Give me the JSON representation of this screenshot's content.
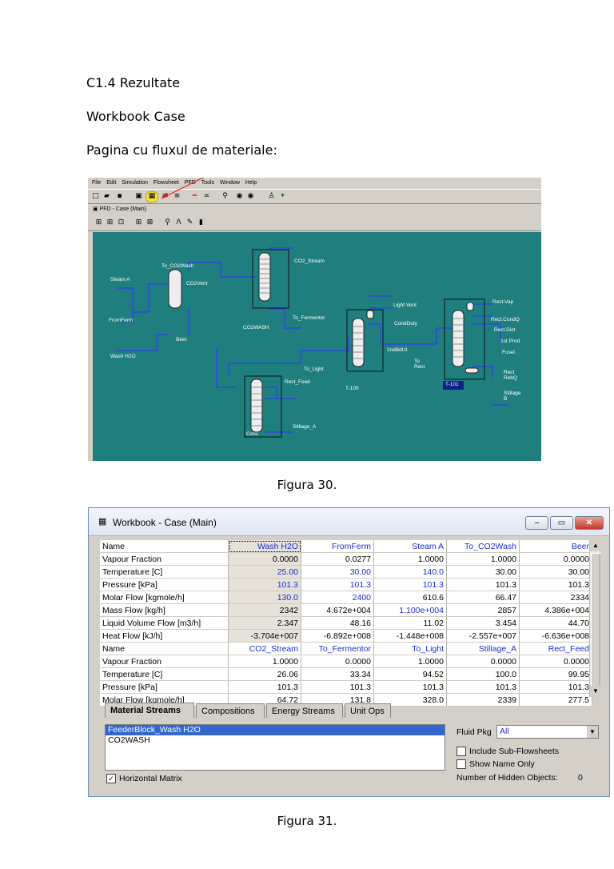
{
  "doc": {
    "section": "C1.4 Rezultate",
    "subsection": "Workbook Case",
    "intro": "Pagina cu fluxul de materiale:",
    "caption1": "Figura 30.",
    "caption2": "Figura 31."
  },
  "pfd": {
    "menu": [
      "File",
      "Edit",
      "Simulation",
      "Flowsheet",
      "PFD",
      "Tools",
      "Window",
      "Help"
    ],
    "window_title": "PFD - Case (Main)",
    "labels": {
      "steam_a": "Steam A",
      "from_ferm": "FromFerm",
      "wash_h2o": "Wash H2O",
      "to_co2wash": "To_CO2Wash",
      "co2vent": "CO2Vent",
      "beer": "Beer",
      "co2_stream": "CO2_Stream",
      "co2wash": "CO2WASH",
      "to_fermentor": "To_Fermentor",
      "light_vent": "Light Vent",
      "cond_duty": "CondDuty",
      "reb_duty": "2ndBdUt",
      "to_rect": "To Rect",
      "to_light": "To_Light",
      "rect_feed": "Rect_Feed",
      "t100": "T-100",
      "conc": "Conc",
      "stillage_a": "Stillage_A",
      "rect_vap": "Rect.Vap",
      "rect_condq": "Rect.CondQ",
      "rect_dist": "Rect.Dist",
      "prod1": "1st Prod",
      "fusel": "Fusel",
      "rect_rebq": "Rect RebQ",
      "stillage_b": "Stillage B",
      "t101": "T-101"
    }
  },
  "workbook": {
    "title": "Workbook - Case (Main)",
    "buttons": {
      "min": "–",
      "max": "▭",
      "close": "✕"
    },
    "rows": [
      {
        "name": "Name",
        "hdr": true,
        "cells": [
          "Wash H2O",
          "FromFerm",
          "Steam A",
          "To_CO2Wash",
          "Beer"
        ]
      },
      {
        "name": "Vapour Fraction",
        "cells": [
          "0.0000",
          "0.0277",
          "1.0000",
          "1.0000",
          "0.0000"
        ]
      },
      {
        "name": "Temperature [C]",
        "cells": [
          "25.00",
          "30.00",
          "140.0",
          "30.00",
          "30.00"
        ],
        "blue": [
          0,
          1,
          2
        ]
      },
      {
        "name": "Pressure [kPa]",
        "cells": [
          "101.3",
          "101.3",
          "101.3",
          "101.3",
          "101.3"
        ],
        "blue": [
          0,
          1,
          2
        ]
      },
      {
        "name": "Molar Flow [kgmole/h]",
        "cells": [
          "130.0",
          "2400",
          "610.6",
          "66.47",
          "2334"
        ],
        "blue": [
          0,
          1
        ]
      },
      {
        "name": "Mass Flow [kg/h]",
        "cells": [
          "2342",
          "4.672e+004",
          "1.100e+004",
          "2857",
          "4.386e+004"
        ],
        "blue": [
          2
        ]
      },
      {
        "name": "Liquid Volume Flow [m3/h]",
        "cells": [
          "2.347",
          "48.16",
          "11.02",
          "3.454",
          "44.70"
        ]
      },
      {
        "name": "Heat Flow [kJ/h]",
        "cells": [
          "-3.704e+007",
          "-6.892e+008",
          "-1.448e+008",
          "-2.557e+007",
          "-6.636e+008"
        ]
      },
      {
        "name": "Name",
        "hdr": true,
        "cells": [
          "CO2_Stream",
          "To_Fermentor",
          "To_Light",
          "Stillage_A",
          "Rect_Feed"
        ]
      },
      {
        "name": "Vapour Fraction",
        "cells": [
          "1.0000",
          "0.0000",
          "1.0000",
          "0.0000",
          "0.0000"
        ]
      },
      {
        "name": "Temperature [C]",
        "cells": [
          "26.06",
          "33.34",
          "94.52",
          "100.0",
          "99.95"
        ]
      },
      {
        "name": "Pressure [kPa]",
        "cells": [
          "101.3",
          "101.3",
          "101.3",
          "101.3",
          "101.3"
        ]
      },
      {
        "name": "Molar Flow [kgmole/h]",
        "cells": [
          "64.72",
          "131.8",
          "328.0",
          "2339",
          "277.5"
        ]
      }
    ],
    "tabs": [
      "Material Streams",
      "Compositions",
      "Energy Streams",
      "Unit Ops"
    ],
    "list_items": [
      "FeederBlock_Wash H2O",
      "CO2WASH"
    ],
    "horizontal_matrix": "Horizontal Matrix",
    "fluid_pkg_label": "Fluid Pkg",
    "fluid_pkg_value": "All",
    "include_sub": "Include Sub-Flowsheets",
    "show_name_only": "Show Name Only",
    "hidden_label": "Number of Hidden Objects:",
    "hidden_value": "0"
  }
}
